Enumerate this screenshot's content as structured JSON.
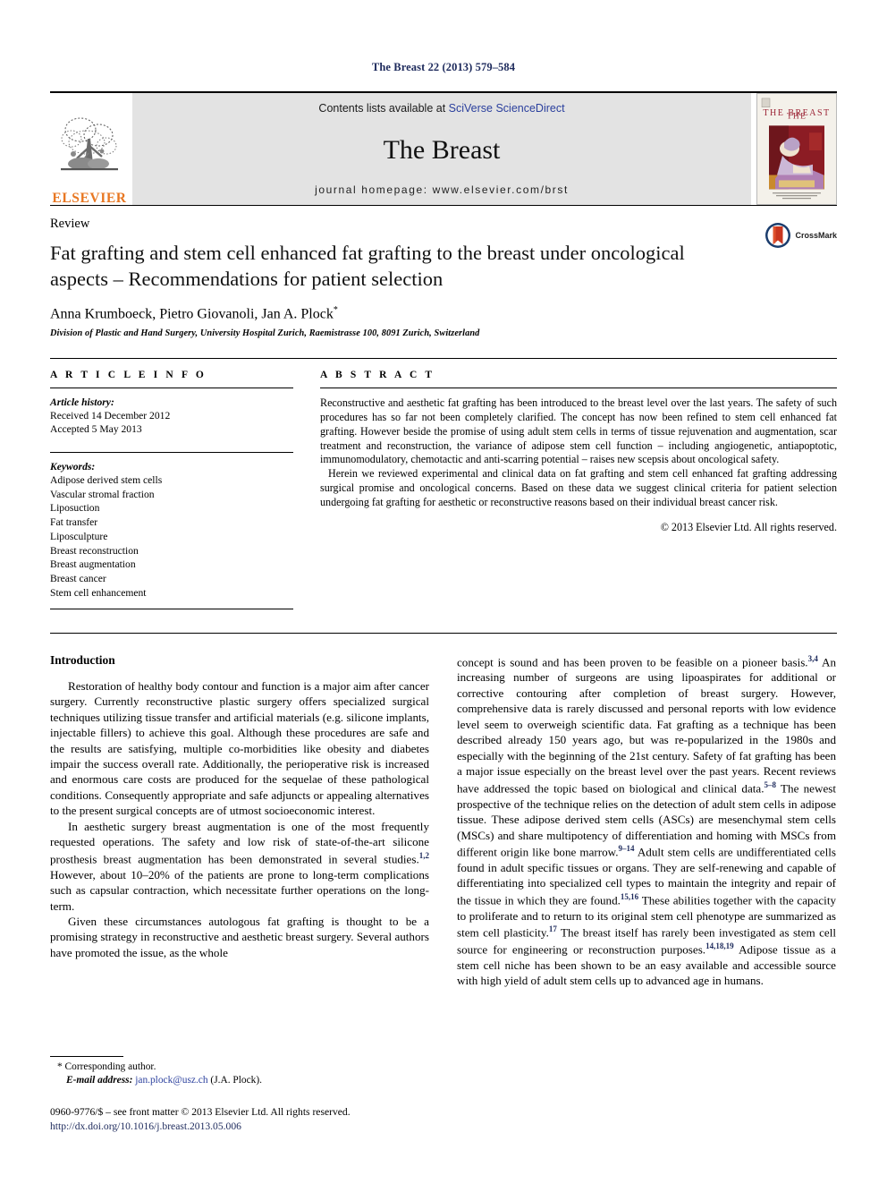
{
  "running_head": "The Breast 22 (2013) 579–584",
  "masthead": {
    "publisher_logo_word": "ELSEVIER",
    "contents_prefix": "Contents lists available at",
    "contents_link": "SciVerse ScienceDirect",
    "journal_title": "The Breast",
    "homepage": "journal homepage: www.elsevier.com/brst",
    "cover_title": "THE BREAST",
    "accent_blue": "#2a3f9d",
    "banner_bg": "#e3e3e3",
    "elsevier_orange": "#e87722"
  },
  "article": {
    "doctype": "Review",
    "title": "Fat grafting and stem cell enhanced fat grafting to the breast under oncological aspects – Recommendations for patient selection",
    "authors": "Anna Krumboeck, Pietro Giovanoli, Jan A. Plock",
    "corresponding_marker": "*",
    "affiliation": "Division of Plastic and Hand Surgery, University Hospital Zurich, Raemistrasse 100, 8091 Zurich, Switzerland",
    "crossmark_label": "CrossMark"
  },
  "article_info": {
    "heading": "A R T I C L E   I N F O",
    "history_label": "Article history:",
    "received": "Received 14 December 2012",
    "accepted": "Accepted 5 May 2013",
    "keywords_label": "Keywords:",
    "keywords": [
      "Adipose derived stem cells",
      "Vascular stromal fraction",
      "Liposuction",
      "Fat transfer",
      "Liposculpture",
      "Breast reconstruction",
      "Breast augmentation",
      "Breast cancer",
      "Stem cell enhancement"
    ]
  },
  "abstract": {
    "heading": "A B S T R A C T",
    "paragraphs": [
      "Reconstructive and aesthetic fat grafting has been introduced to the breast level over the last years. The safety of such procedures has so far not been completely clarified. The concept has now been refined to stem cell enhanced fat grafting. However beside the promise of using adult stem cells in terms of tissue rejuvenation and augmentation, scar treatment and reconstruction, the variance of adipose stem cell function – including angiogenetic, antiapoptotic, immunomodulatory, chemotactic and anti-scarring potential – raises new scepsis about oncological safety.",
      "Herein we reviewed experimental and clinical data on fat grafting and stem cell enhanced fat grafting addressing surgical promise and oncological concerns. Based on these data we suggest clinical criteria for patient selection undergoing fat grafting for aesthetic or reconstructive reasons based on their individual breast cancer risk."
    ],
    "copyright": "© 2013 Elsevier Ltd. All rights reserved."
  },
  "body": {
    "left_heading": "Introduction",
    "left_paragraphs": [
      "Restoration of healthy body contour and function is a major aim after cancer surgery. Currently reconstructive plastic surgery offers specialized surgical techniques utilizing tissue transfer and artificial materials (e.g. silicone implants, injectable fillers) to achieve this goal. Although these procedures are safe and the results are satisfying, multiple co-morbidities like obesity and diabetes impair the success overall rate. Additionally, the perioperative risk is increased and enormous care costs are produced for the sequelae of these pathological conditions. Consequently appropriate and safe adjuncts or appealing alternatives to the present surgical concepts are of utmost socioeconomic interest.",
      "In aesthetic surgery breast augmentation is one of the most frequently requested operations. The safety and low risk of state-of-the-art silicone prosthesis breast augmentation has been demonstrated in several studies.<sup>1,2</sup> However, about 10–20% of the patients are prone to long-term complications such as capsular contraction, which necessitate further operations on the long-term.",
      "Given these circumstances autologous fat grafting is thought to be a promising strategy in reconstructive and aesthetic breast surgery. Several authors have promoted the issue, as the whole"
    ],
    "right_paragraphs": [
      "concept is sound and has been proven to be feasible on a pioneer basis.<sup>3,4</sup> An increasing number of surgeons are using lipoaspirates for additional or corrective contouring after completion of breast surgery. However, comprehensive data is rarely discussed and personal reports with low evidence level seem to overweigh scientific data. Fat grafting as a technique has been described already 150 years ago, but was re-popularized in the 1980s and especially with the beginning of the 21st century. Safety of fat grafting has been a major issue especially on the breast level over the past years. Recent reviews have addressed the topic based on biological and clinical data.<sup>5–8</sup> The newest prospective of the technique relies on the detection of adult stem cells in adipose tissue. These adipose derived stem cells (ASCs) are mesenchymal stem cells (MSCs) and share multipotency of differentiation and homing with MSCs from different origin like bone marrow.<sup>9–14</sup> Adult stem cells are undifferentiated cells found in adult specific tissues or organs. They are self-renewing and capable of differentiating into specialized cell types to maintain the integrity and repair of the tissue in which they are found.<sup>15,16</sup> These abilities together with the capacity to proliferate and to return to its original stem cell phenotype are summarized as stem cell plasticity.<sup>17</sup> The breast itself has rarely been investigated as stem cell source for engineering or reconstruction purposes.<sup>14,18,19</sup> Adipose tissue as a stem cell niche has been shown to be an easy available and accessible source with high yield of adult stem cells up to advanced age in humans."
    ]
  },
  "footer": {
    "corresponding_author": "* Corresponding author.",
    "email_label": "E-mail address:",
    "email": "jan.plock@usz.ch",
    "email_suffix": "(J.A. Plock).",
    "imprint": "0960-9776/$ – see front matter © 2013 Elsevier Ltd. All rights reserved.",
    "doi": "http://dx.doi.org/10.1016/j.breast.2013.05.006"
  }
}
